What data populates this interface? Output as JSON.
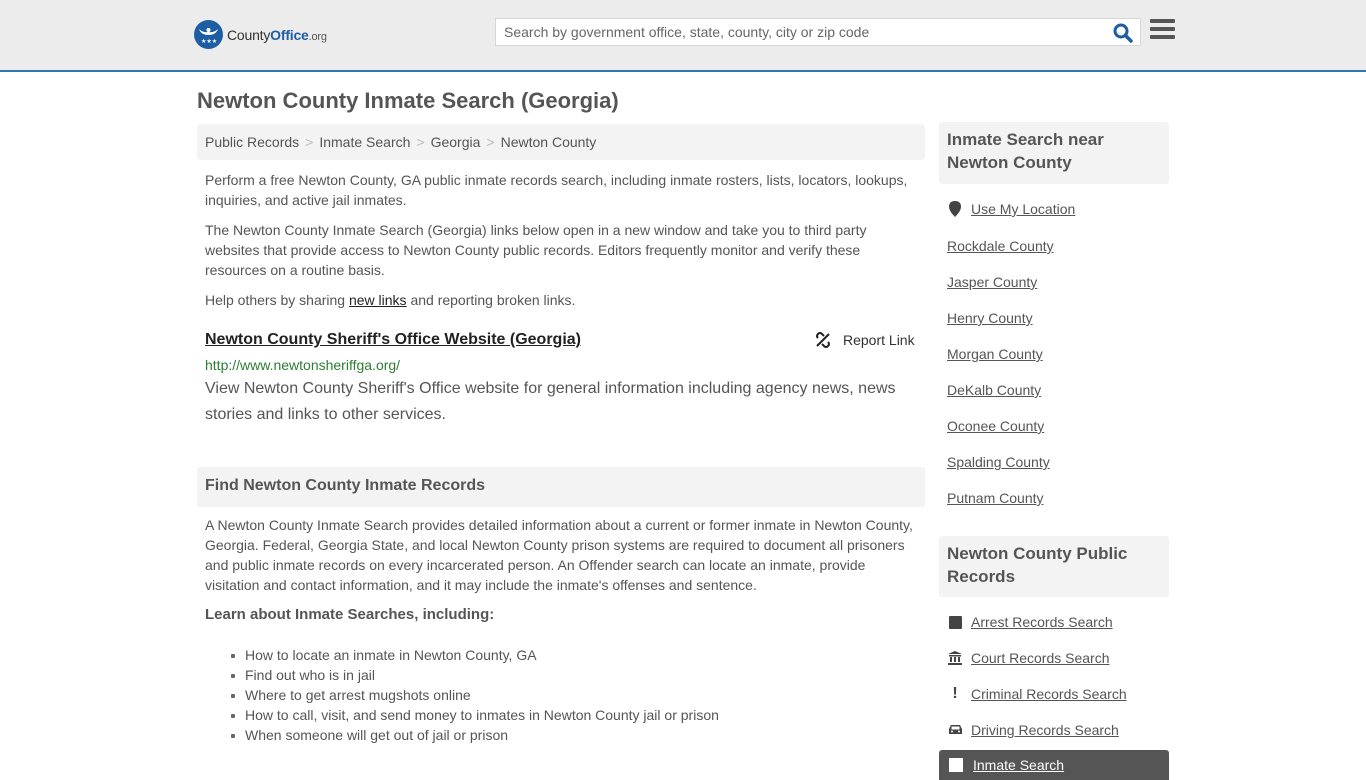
{
  "header": {
    "logo": {
      "name_part1": "County",
      "name_part2": "Office",
      "name_suffix": ".org"
    },
    "search": {
      "placeholder": "Search by government office, state, county, city or zip code",
      "value": ""
    }
  },
  "page": {
    "title": "Newton County Inmate Search (Georgia)"
  },
  "breadcrumb": [
    {
      "label": "Public Records"
    },
    {
      "label": "Inmate Search"
    },
    {
      "label": "Georgia"
    },
    {
      "label": "Newton County"
    }
  ],
  "breadcrumb_separator": ">",
  "intro": {
    "p1": "Perform a free Newton County, GA public inmate records search, including inmate rosters, lists, locators, lookups, inquiries, and active jail inmates.",
    "p2": "The Newton County Inmate Search (Georgia) links below open in a new window and take you to third party websites that provide access to Newton County public records. Editors frequently monitor and verify these resources on a routine basis.",
    "p3_before": "Help others by sharing ",
    "p3_link": "new links",
    "p3_after": " and reporting broken links."
  },
  "result": {
    "title": "Newton County Sheriff's Office Website (Georgia)",
    "url": "http://www.newtonsheriffga.org/",
    "description": "View Newton County Sheriff's Office website for general information including agency news, news stories and links to other services.",
    "report_label": "Report Link"
  },
  "find_section": {
    "heading": "Find Newton County Inmate Records",
    "body": "A Newton County Inmate Search provides detailed information about a current or former inmate in Newton County, Georgia. Federal, Georgia State, and local Newton County prison systems are required to document all prisoners and public inmate records on every incarcerated person. An Offender search can locate an inmate, provide visitation and contact information, and it may include the inmate's offenses and sentence.",
    "learn_heading": "Learn about Inmate Searches, including:",
    "learn_items": [
      "How to locate an inmate in Newton County, GA",
      "Find out who is in jail",
      "Where to get arrest mugshots online",
      "How to call, visit, and send money to inmates in Newton County jail or prison",
      "When someone will get out of jail or prison"
    ]
  },
  "sidebar": {
    "nearby_heading": "Inmate Search near Newton County",
    "use_location": "Use My Location",
    "nearby": [
      "Rockdale County",
      "Jasper County",
      "Henry County",
      "Morgan County",
      "DeKalb County",
      "Oconee County",
      "Spalding County",
      "Putnam County"
    ],
    "records_heading": "Newton County Public Records",
    "records": [
      {
        "label": "Arrest Records Search",
        "icon": "square-icon"
      },
      {
        "label": "Court Records Search",
        "icon": "courthouse-icon"
      },
      {
        "label": "Criminal Records Search",
        "icon": "exclamation-icon"
      },
      {
        "label": "Driving Records Search",
        "icon": "car-icon"
      },
      {
        "label": "Inmate Search",
        "icon": "inmate-icon",
        "active": true
      }
    ]
  },
  "colors": {
    "brand": "#1d5ea3",
    "header_border": "#2e77ac",
    "url_green": "#2e7d32",
    "active_bg": "#555555"
  }
}
